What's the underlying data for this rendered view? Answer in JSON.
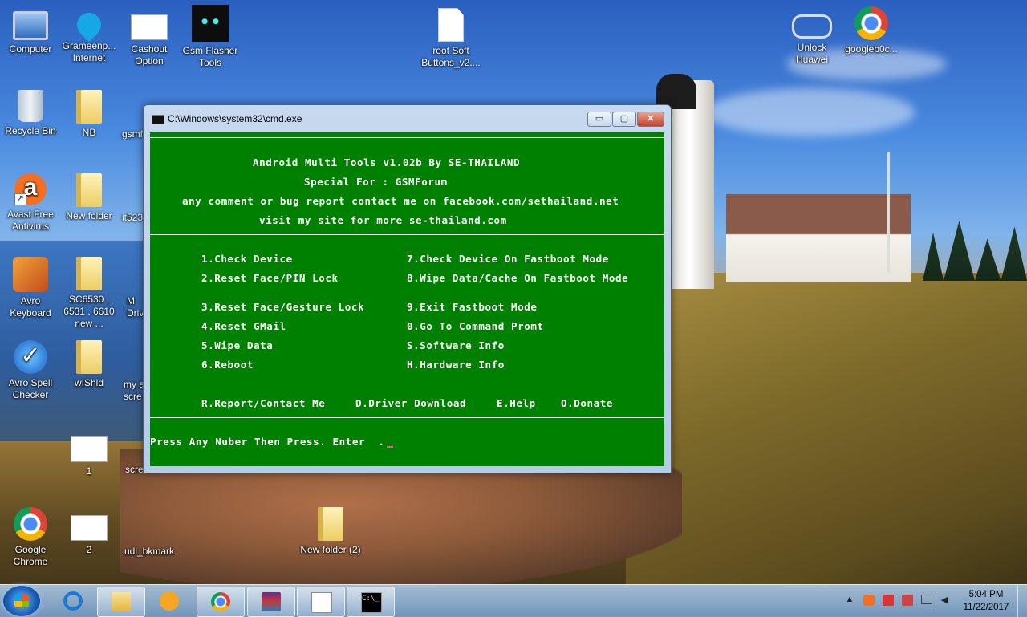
{
  "desktop": {
    "icons": [
      {
        "label": "Computer",
        "icon": "computer-icon"
      },
      {
        "label": "Grameenp... Internet",
        "icon": "grameenphone-icon"
      },
      {
        "label": "Cashout Option",
        "icon": "screenshot-file-icon"
      },
      {
        "label": "Gsm Flasher Tools",
        "icon": "gsm-flasher-icon"
      },
      {
        "label": "root Soft Buttons_v2....",
        "icon": "document-icon"
      },
      {
        "label": "Unlock Huawei",
        "icon": "chain-icon"
      },
      {
        "label": "googleb0c...",
        "icon": "chrome-icon"
      },
      {
        "label": "Recycle Bin",
        "icon": "recycle-bin-icon"
      },
      {
        "label": "NB",
        "icon": "folder-icon"
      },
      {
        "label": "gsmf",
        "icon": "file-icon"
      },
      {
        "label": "Avast Free Antivirus",
        "icon": "avast-icon"
      },
      {
        "label": "New folder",
        "icon": "folder-icon"
      },
      {
        "label": "it523",
        "icon": "file-icon"
      },
      {
        "label": "Avro Keyboard",
        "icon": "avro-icon"
      },
      {
        "label": "SC6530 , 6531 , 6610 new ...",
        "icon": "folder-icon"
      },
      {
        "label": "M Drive",
        "icon": "file-icon"
      },
      {
        "label": "Avro Spell Checker",
        "icon": "spell-checker-icon"
      },
      {
        "label": "wIShld",
        "icon": "folder-icon"
      },
      {
        "label": "my a scre",
        "icon": "file-icon"
      },
      {
        "label": "1",
        "icon": "screenshot-file-icon"
      },
      {
        "label": "scre",
        "icon": "file-icon"
      },
      {
        "label": "Google Chrome",
        "icon": "chrome-icon"
      },
      {
        "label": "2",
        "icon": "screenshot-file-icon"
      },
      {
        "label": "udl_bkmark",
        "icon": "file-icon"
      },
      {
        "label": "New folder (2)",
        "icon": "folder-icon"
      }
    ]
  },
  "cmd_window": {
    "title": "C:\\Windows\\system32\\cmd.exe",
    "buttons": {
      "minimize": "▭",
      "maximize": "▢",
      "close": "✕"
    },
    "header_lines": [
      "Android Multi Tools v1.02b By SE-THAILAND",
      "Special For : GSMForum",
      "any comment or bug report contact me on facebook.com/sethailand.net",
      "visit my site for more se-thailand.com"
    ],
    "menu_left": [
      "1.Check Device",
      "2.Reset Face/PIN Lock",
      "3.Reset Face/Gesture Lock",
      "4.Reset GMail",
      "5.Wipe Data",
      "6.Reboot"
    ],
    "menu_right": [
      "7.Check Device On Fastboot Mode",
      "8.Wipe Data/Cache On Fastboot Mode",
      "9.Exit Fastboot Mode",
      "0.Go To Command Promt",
      "S.Software Info",
      "H.Hardware Info"
    ],
    "footer_options": [
      "R.Report/Contact Me",
      "D.Driver Download",
      "E.Help",
      "O.Donate"
    ],
    "prompt": "Press Any Nuber Then Press. Enter  ."
  },
  "taskbar": {
    "start": "start-button",
    "items": [
      "internet-explorer",
      "windows-explorer",
      "media-player",
      "google-chrome",
      "winrar",
      "wordpad",
      "command-prompt"
    ],
    "clock": {
      "time": "5:04 PM",
      "date": "11/22/2017"
    },
    "tray_arrow": "▲"
  }
}
